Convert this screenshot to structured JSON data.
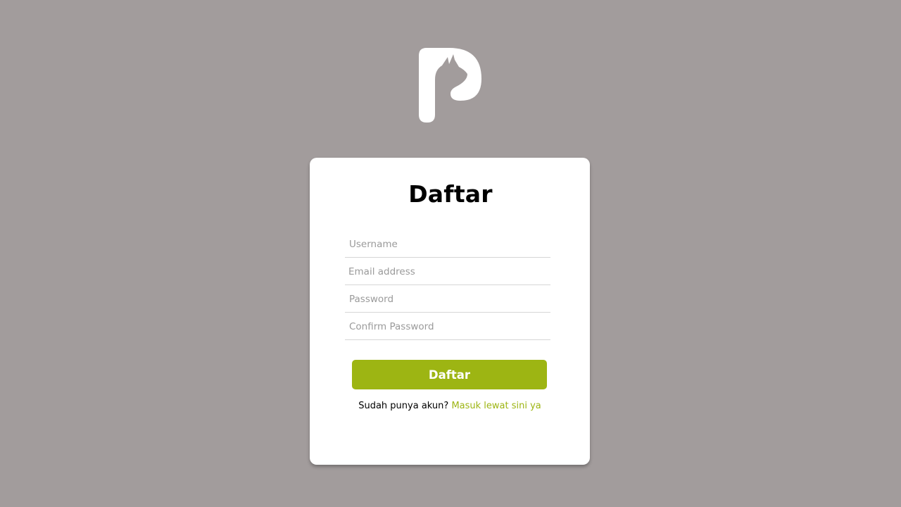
{
  "brand": {
    "logo_icon": "llama-p-logo-icon",
    "accent_color": "#9db513",
    "background_color": "#a29c9c"
  },
  "form": {
    "title": "Daftar",
    "username_placeholder": "Username",
    "email_placeholder": "Email address",
    "password_placeholder": "Password",
    "confirm_password_placeholder": "Confirm Password",
    "submit_label": "Daftar"
  },
  "footer": {
    "prompt": "Sudah punya akun? ",
    "login_link": "Masuk lewat sini ya"
  }
}
